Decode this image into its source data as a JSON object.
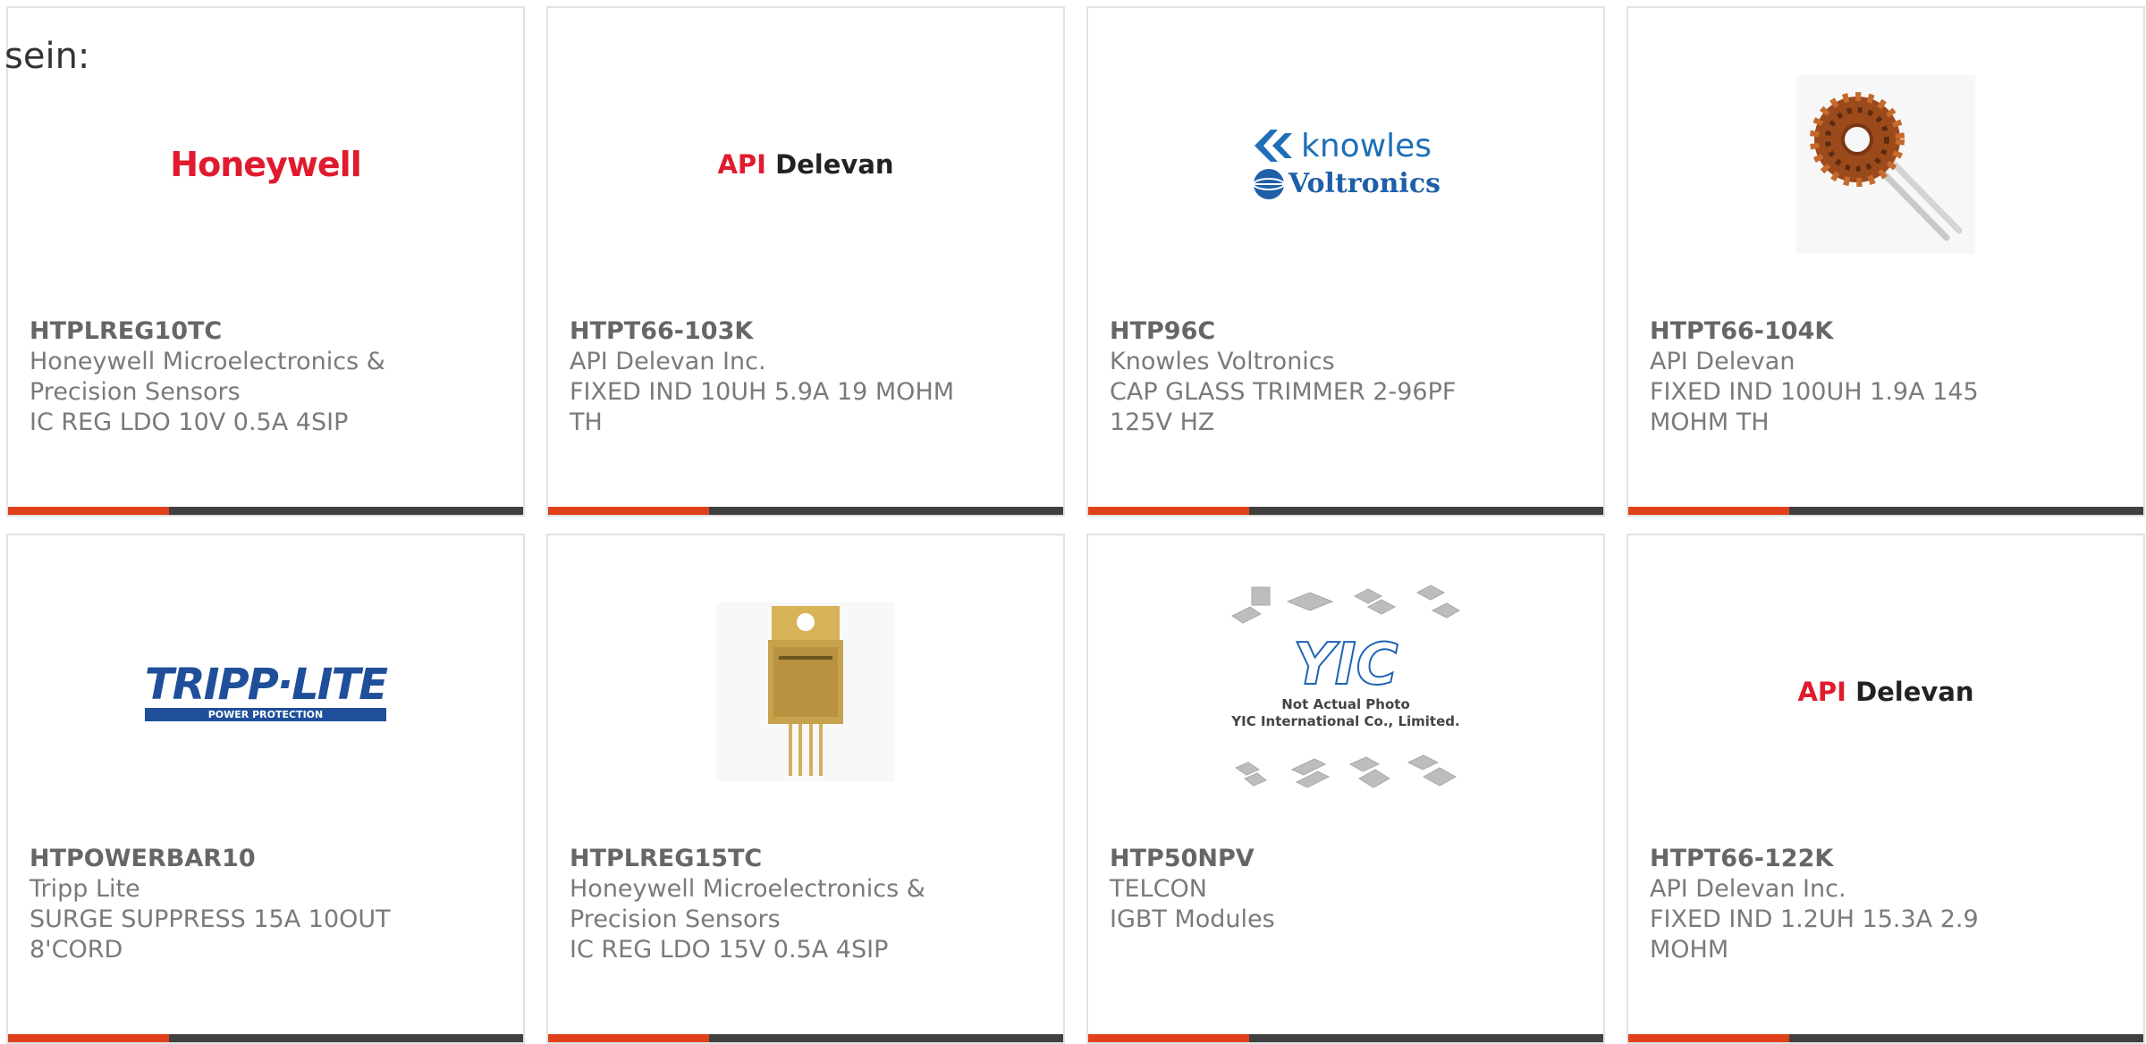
{
  "intro": "sein:",
  "colors": {
    "accent": "#e1411a",
    "bar": "#404040",
    "border": "#e2e2e2",
    "text": "#7a7a7a"
  },
  "products": [
    {
      "part": "HTPLREG10TC",
      "lines": [
        "Honeywell Microelectronics &",
        "Precision Sensors",
        "IC REG LDO 10V 0.5A 4SIP"
      ],
      "image": {
        "type": "logo-honeywell",
        "text": "Honeywell"
      }
    },
    {
      "part": "HTPT66-103K",
      "lines": [
        "API Delevan Inc.",
        "FIXED IND 10UH 5.9A 19 MOHM",
        "TH"
      ],
      "image": {
        "type": "logo-api",
        "a": "API",
        "b": "Delevan"
      }
    },
    {
      "part": "HTP96C",
      "lines": [
        "Knowles Voltronics",
        "CAP GLASS TRIMMER 2-96PF",
        "125V HZ"
      ],
      "image": {
        "type": "logo-knowles",
        "a": "knowles",
        "b": "Voltronics"
      }
    },
    {
      "part": "HTPT66-104K",
      "lines": [
        "API Delevan",
        "FIXED IND 100UH 1.9A 145",
        "MOHM TH"
      ],
      "image": {
        "type": "photo-toroid"
      }
    },
    {
      "part": "HTPOWERBAR10",
      "lines": [
        "Tripp Lite",
        "SURGE SUPPRESS 15A 10OUT",
        "8'CORD"
      ],
      "image": {
        "type": "logo-tripp",
        "a": "TRIPP·LITE",
        "b": "POWER PROTECTION"
      }
    },
    {
      "part": "HTPLREG15TC",
      "lines": [
        "Honeywell Microelectronics &",
        "Precision Sensors",
        "IC REG LDO 15V 0.5A 4SIP"
      ],
      "image": {
        "type": "photo-regulator"
      }
    },
    {
      "part": "HTP50NPV",
      "lines": [
        "TELCON",
        "IGBT Modules"
      ],
      "image": {
        "type": "placeholder-yic",
        "a": "YIC",
        "b": "Not Actual Photo",
        "c": "YIC International Co., Limited."
      }
    },
    {
      "part": "HTPT66-122K",
      "lines": [
        "API Delevan Inc.",
        "FIXED IND 1.2UH 15.3A 2.9",
        "MOHM"
      ],
      "image": {
        "type": "logo-api",
        "a": "API",
        "b": "Delevan"
      }
    }
  ]
}
